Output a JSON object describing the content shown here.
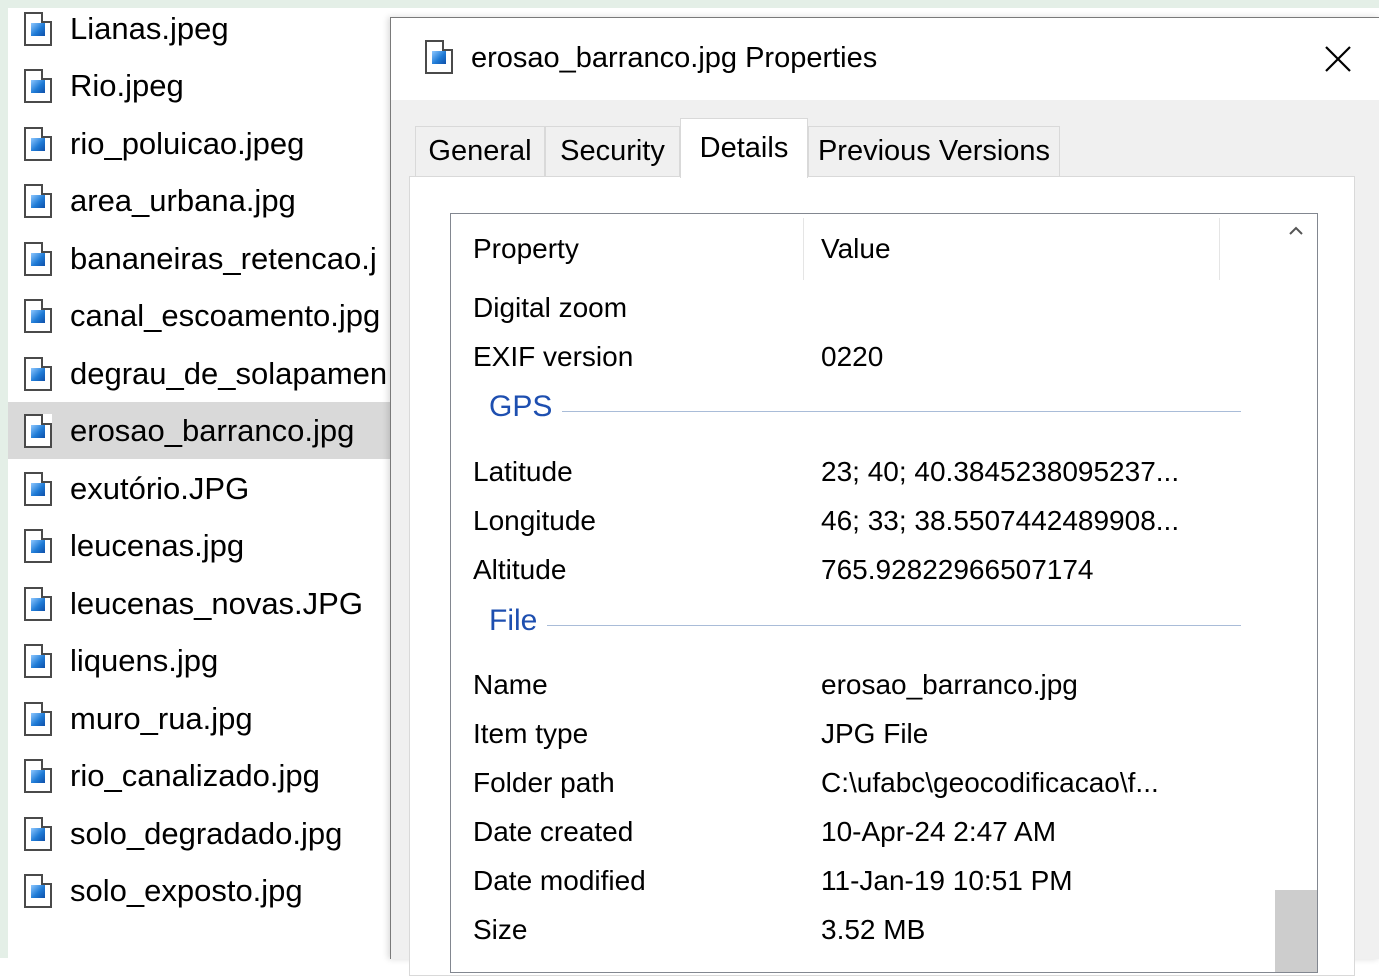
{
  "explorer": {
    "files": [
      {
        "name": "Lianas.jpeg"
      },
      {
        "name": "Rio.jpeg"
      },
      {
        "name": "rio_poluicao.jpeg"
      },
      {
        "name": "area_urbana.jpg"
      },
      {
        "name": "bananeiras_retencao.j"
      },
      {
        "name": "canal_escoamento.jpg"
      },
      {
        "name": "degrau_de_solapamen"
      },
      {
        "name": "erosao_barranco.jpg",
        "selected": true
      },
      {
        "name": "exutório.JPG"
      },
      {
        "name": "leucenas.jpg"
      },
      {
        "name": "leucenas_novas.JPG"
      },
      {
        "name": "liquens.jpg"
      },
      {
        "name": "muro_rua.jpg"
      },
      {
        "name": "rio_canalizado.jpg"
      },
      {
        "name": "solo_degradado.jpg"
      },
      {
        "name": "solo_exposto.jpg"
      }
    ]
  },
  "dialog": {
    "title": "erosao_barranco.jpg Properties",
    "close_icon": "close-icon",
    "tabs": [
      {
        "label": "General"
      },
      {
        "label": "Security"
      },
      {
        "label": "Details",
        "active": true
      },
      {
        "label": "Previous Versions"
      }
    ],
    "details": {
      "column_property": "Property",
      "column_value": "Value",
      "rows": [
        {
          "name": "Digital zoom",
          "value": ""
        },
        {
          "name": "EXIF version",
          "value": "0220"
        }
      ],
      "groups": [
        {
          "label": "GPS",
          "rows": [
            {
              "name": "Latitude",
              "value": "23; 40; 40.3845238095237..."
            },
            {
              "name": "Longitude",
              "value": "46; 33; 38.5507442489908..."
            },
            {
              "name": "Altitude",
              "value": "765.92822966507174"
            }
          ]
        },
        {
          "label": "File",
          "rows": [
            {
              "name": "Name",
              "value": "erosao_barranco.jpg"
            },
            {
              "name": "Item type",
              "value": "JPG File"
            },
            {
              "name": "Folder path",
              "value": "C:\\ufabc\\geocodificacao\\f..."
            },
            {
              "name": "Date created",
              "value": "10-Apr-24 2:47 AM"
            },
            {
              "name": "Date modified",
              "value": "11-Jan-19 10:51 PM"
            },
            {
              "name": "Size",
              "value": "3.52 MB"
            }
          ]
        }
      ]
    }
  },
  "colors": {
    "selected_row": "#d9d9d9",
    "group_header": "#1e4fb0",
    "frame": "#e4efe7"
  }
}
